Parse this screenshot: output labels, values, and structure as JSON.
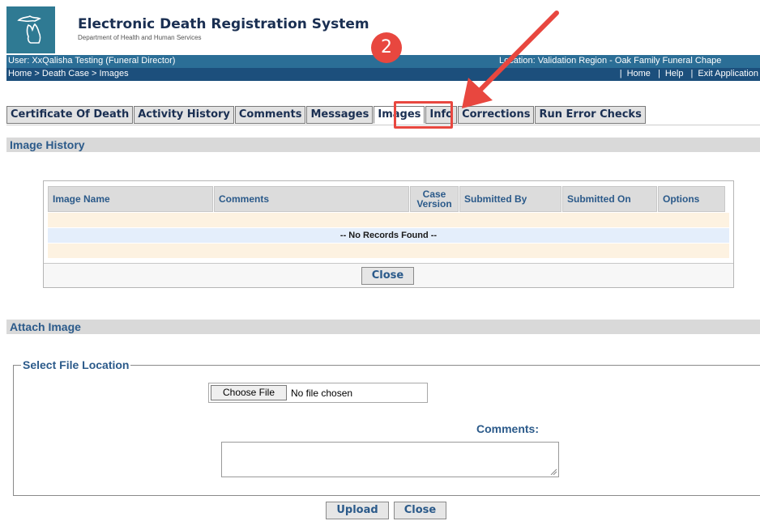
{
  "header": {
    "title": "Electronic Death Registration System",
    "subtitle": "Department of Health and Human Services",
    "logo_icon": "michigan-map-icon"
  },
  "userbar": {
    "user": "User: XxQalisha Testing (Funeral Director)",
    "location": "Location: Validation Region - Oak Family Funeral Chape"
  },
  "navbar": {
    "breadcrumb": "Home > Death Case > Images",
    "links": [
      "Home",
      "Help",
      "Exit Application"
    ]
  },
  "tabs": [
    {
      "label": "Certificate Of Death",
      "active": false
    },
    {
      "label": "Activity History",
      "active": false
    },
    {
      "label": "Comments",
      "active": false
    },
    {
      "label": "Messages",
      "active": false
    },
    {
      "label": "Images",
      "active": true
    },
    {
      "label": "Info",
      "active": false
    },
    {
      "label": "Corrections",
      "active": false
    },
    {
      "label": "Run Error Checks",
      "active": false
    }
  ],
  "image_history": {
    "section_title": "Image History",
    "columns": [
      "Image Name",
      "Comments",
      "Case Version",
      "Submitted By",
      "Submitted On",
      "Options"
    ],
    "empty_message": "-- No Records Found --",
    "close_label": "Close"
  },
  "attach_image": {
    "section_title": "Attach Image",
    "fieldset_legend": "Select File Location",
    "choose_file_label": "Choose File",
    "no_file_label": "No file chosen",
    "comments_label": "Comments:",
    "upload_label": "Upload",
    "close_label": "Close"
  },
  "annotation": {
    "step_number": "2"
  },
  "colors": {
    "userbar": "#2b6e96",
    "navbar": "#1c4f7c",
    "annotation_red": "#e8473f",
    "section_bar": "#d9d9d9"
  }
}
